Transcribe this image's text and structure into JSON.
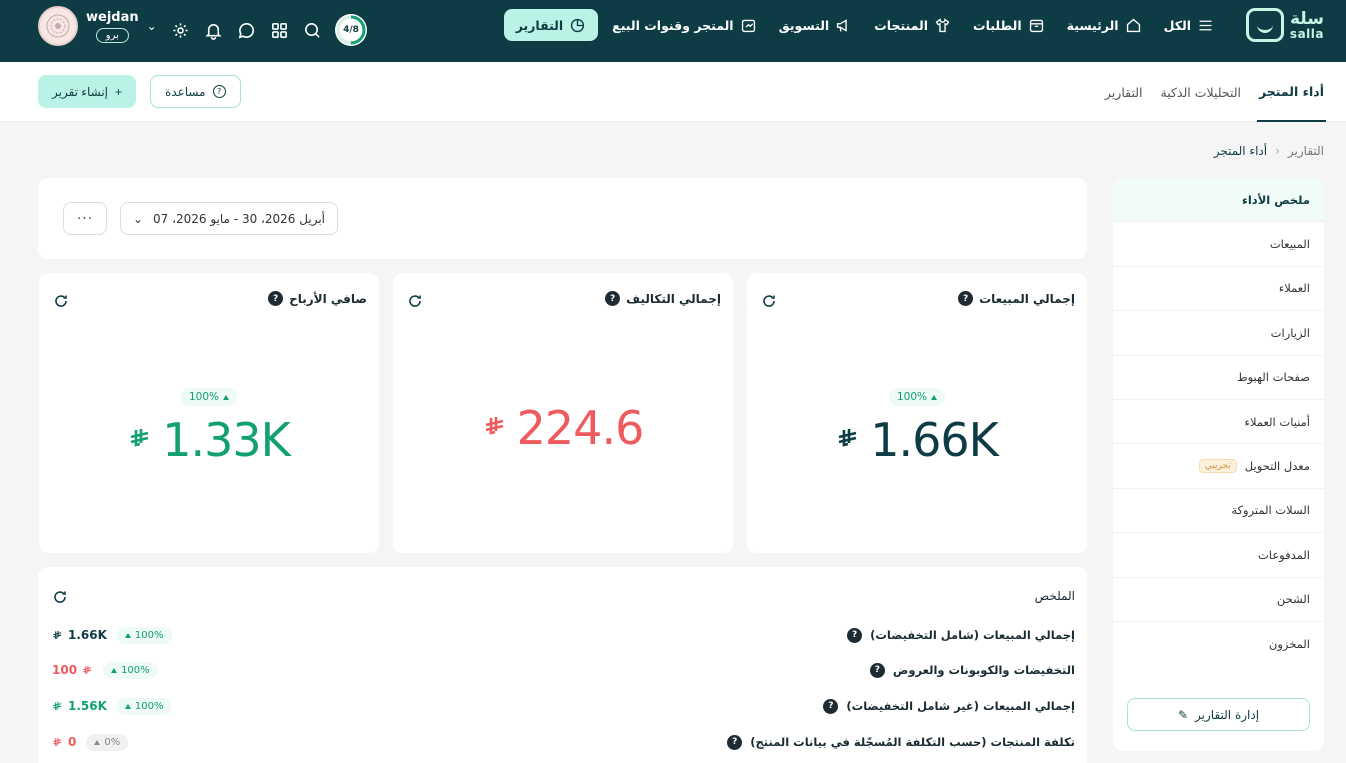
{
  "brand": {
    "name_ar": "سلة",
    "name_en": "salla"
  },
  "nav": {
    "items": [
      {
        "key": "all",
        "label": "الكل",
        "icon": "menu-icon"
      },
      {
        "key": "home",
        "label": "الرئيسية",
        "icon": "home-icon"
      },
      {
        "key": "orders",
        "label": "الطلبات",
        "icon": "box-icon"
      },
      {
        "key": "products",
        "label": "المنتجات",
        "icon": "shirt-icon"
      },
      {
        "key": "marketing",
        "label": "التسويق",
        "icon": "megaphone-icon"
      },
      {
        "key": "channels",
        "label": "المتجر وقنوات البيع",
        "icon": "storefront-icon"
      },
      {
        "key": "reports",
        "label": "التقارير",
        "icon": "pie-chart-icon",
        "active": true
      }
    ]
  },
  "topbar": {
    "onboarding_progress": "4/8",
    "user": {
      "name": "wejdan",
      "plan": "برو"
    }
  },
  "subnav": {
    "tabs": [
      {
        "label": "أداء المتجر",
        "active": true
      },
      {
        "label": "التحليلات الذكية",
        "active": false
      },
      {
        "label": "التقارير",
        "active": false
      }
    ],
    "create_report": "إنشاء تقرير",
    "help": "مساعدة"
  },
  "breadcrumb": {
    "root": "التقارير",
    "current": "أداء المتجر"
  },
  "sidebar": {
    "items": [
      {
        "label": "ملخص الأداء",
        "active": true
      },
      {
        "label": "المبيعات"
      },
      {
        "label": "العملاء"
      },
      {
        "label": "الزيارات"
      },
      {
        "label": "صفحات الهبوط"
      },
      {
        "label": "أمنيات العملاء"
      },
      {
        "label": "معدل التحويل",
        "badge": "تجريبي"
      },
      {
        "label": "السلات المتروكة"
      },
      {
        "label": "المدفوعات"
      },
      {
        "label": "الشحن"
      },
      {
        "label": "المخزون"
      }
    ],
    "manage": "إدارة التقارير"
  },
  "filters": {
    "date_range": "أبريل 2026، 30  -  مايو 2026، 07",
    "more": "···"
  },
  "kpis": {
    "sales": {
      "title": "إجمالي المبيعات",
      "value": "1.66K",
      "delta": "100%",
      "color": "#0d3c44"
    },
    "costs": {
      "title": "إجمالي التكاليف",
      "value": "224.6",
      "color": "#ef5a5f"
    },
    "profit": {
      "title": "صافي الأرباح",
      "value": "1.33K",
      "delta": "100%",
      "color": "#12a06e"
    }
  },
  "summary": {
    "title": "الملخص",
    "rows": [
      {
        "label": "إجمالي المبيعات (شامل التخفيضات)",
        "delta": "100%",
        "value": "1.66K",
        "color": "#0d3c44"
      },
      {
        "label": "التخفيضات والكوبونات والعروض",
        "delta": "100%",
        "value": "100",
        "color": "#ef5a5f"
      },
      {
        "label": "إجمالي المبيعات (غير شامل التخفيضات)",
        "delta": "100%",
        "value": "1.56K",
        "color": "#12a06e"
      },
      {
        "label": "تكلفة المنتجات (حسب التكلفة المُسجّلة في بيانات المنتج)",
        "delta": "0%",
        "value": "0",
        "color": "#ef5a5f",
        "neutral": true
      }
    ]
  },
  "colors": {
    "primary": "#0d3c44",
    "accent": "#baf3e6",
    "positive": "#12a06e",
    "negative": "#ef5a5f"
  }
}
